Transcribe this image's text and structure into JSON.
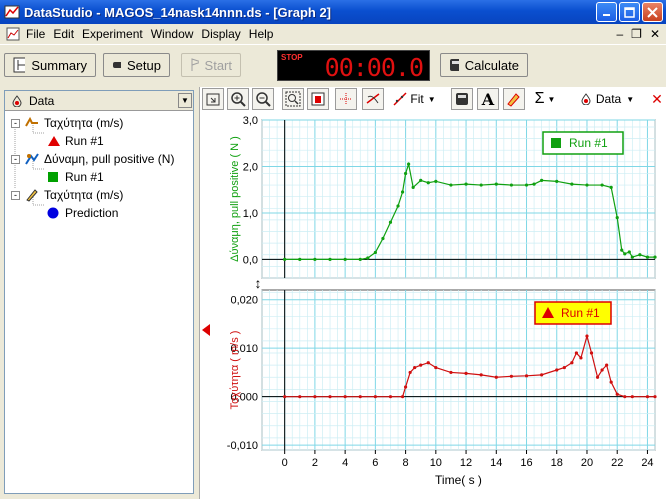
{
  "window": {
    "title": "DataStudio - MAGOS_14nask14nnn.ds - [Graph 2]"
  },
  "menu": {
    "items": [
      "File",
      "Edit",
      "Experiment",
      "Window",
      "Display",
      "Help"
    ]
  },
  "toolbar": {
    "summary_label": "Summary",
    "setup_label": "Setup",
    "start_label": "Start",
    "timer_status": "STOP",
    "timer_value": "00:00.0",
    "calculate_label": "Calculate"
  },
  "data_panel": {
    "header_label": "Data",
    "items": [
      {
        "label": "Ταχύτητα (m/s)",
        "run": "Run #1",
        "run_marker": "triangle",
        "color": "#e00000"
      },
      {
        "label": "Δύναμη, pull positive (N)",
        "run": "Run #1",
        "run_marker": "square",
        "color": "#00a000"
      },
      {
        "label": "Ταχύτητα (m/s)",
        "run": "Prediction",
        "run_marker": "circle",
        "color": "#0000e0"
      }
    ]
  },
  "graph_toolbar": {
    "fit_label": "Fit",
    "data_label": "Data",
    "text_tool": "A",
    "sigma_tool": "Σ"
  },
  "chart_data": [
    {
      "type": "line",
      "ylabel": "Δύναμη, pull positive ( N )",
      "ylim": [
        -0.4,
        3.0
      ],
      "yticks": [
        "3,0",
        "2,0",
        "1,0",
        "0,0"
      ],
      "legend": "Run #1",
      "legend_marker": "square",
      "color": "#10a010",
      "x": [
        0,
        1,
        2,
        3,
        4,
        5,
        5.5,
        6,
        6.5,
        7,
        7.5,
        7.8,
        8,
        8.2,
        8.5,
        9,
        9.5,
        10,
        11,
        12,
        13,
        14,
        15,
        16,
        16.5,
        17,
        18,
        19,
        20,
        21,
        21.6,
        22,
        22.3,
        22.5,
        22.8,
        23,
        23.5,
        24,
        24.5
      ],
      "y": [
        0.0,
        0.0,
        0.0,
        0.0,
        0.0,
        0.0,
        0.03,
        0.15,
        0.45,
        0.8,
        1.15,
        1.45,
        1.85,
        2.05,
        1.55,
        1.7,
        1.65,
        1.68,
        1.6,
        1.62,
        1.6,
        1.62,
        1.6,
        1.6,
        1.62,
        1.7,
        1.68,
        1.62,
        1.6,
        1.6,
        1.55,
        0.9,
        0.2,
        0.12,
        0.16,
        0.05,
        0.1,
        0.05,
        0.05
      ],
      "grid": true
    },
    {
      "type": "line",
      "ylabel": "Ταχύτητα ( m/s )",
      "ylim": [
        -0.011,
        0.022
      ],
      "yticks": [
        "0,020",
        "0,010",
        "0,000",
        "-0,010"
      ],
      "legend": "Run #1",
      "legend_marker": "triangle",
      "color": "#d01010",
      "x": [
        0,
        1,
        2,
        3,
        4,
        5,
        6,
        7,
        7.8,
        8,
        8.3,
        8.6,
        9,
        9.5,
        10,
        11,
        12,
        13,
        14,
        15,
        16,
        17,
        18,
        18.5,
        19,
        19.3,
        19.6,
        20,
        20.3,
        20.7,
        21,
        21.3,
        21.6,
        22,
        22.5,
        23,
        24,
        24.5
      ],
      "y": [
        0.0,
        0.0,
        0.0,
        0.0,
        0.0,
        0.0,
        0.0,
        0.0,
        0.0,
        0.002,
        0.005,
        0.006,
        0.0065,
        0.007,
        0.006,
        0.005,
        0.0048,
        0.0045,
        0.004,
        0.0042,
        0.0043,
        0.0045,
        0.0055,
        0.006,
        0.007,
        0.009,
        0.008,
        0.0125,
        0.009,
        0.004,
        0.0055,
        0.0065,
        0.003,
        0.0005,
        0.0,
        0.0,
        0.0,
        0.0
      ],
      "grid": true
    }
  ],
  "x_axis": {
    "label": "Time( s )",
    "xlim": [
      -1.5,
      24.5
    ],
    "ticks": [
      "0",
      "2",
      "4",
      "6",
      "8",
      "10",
      "12",
      "14",
      "16",
      "18",
      "20",
      "22",
      "24"
    ]
  }
}
